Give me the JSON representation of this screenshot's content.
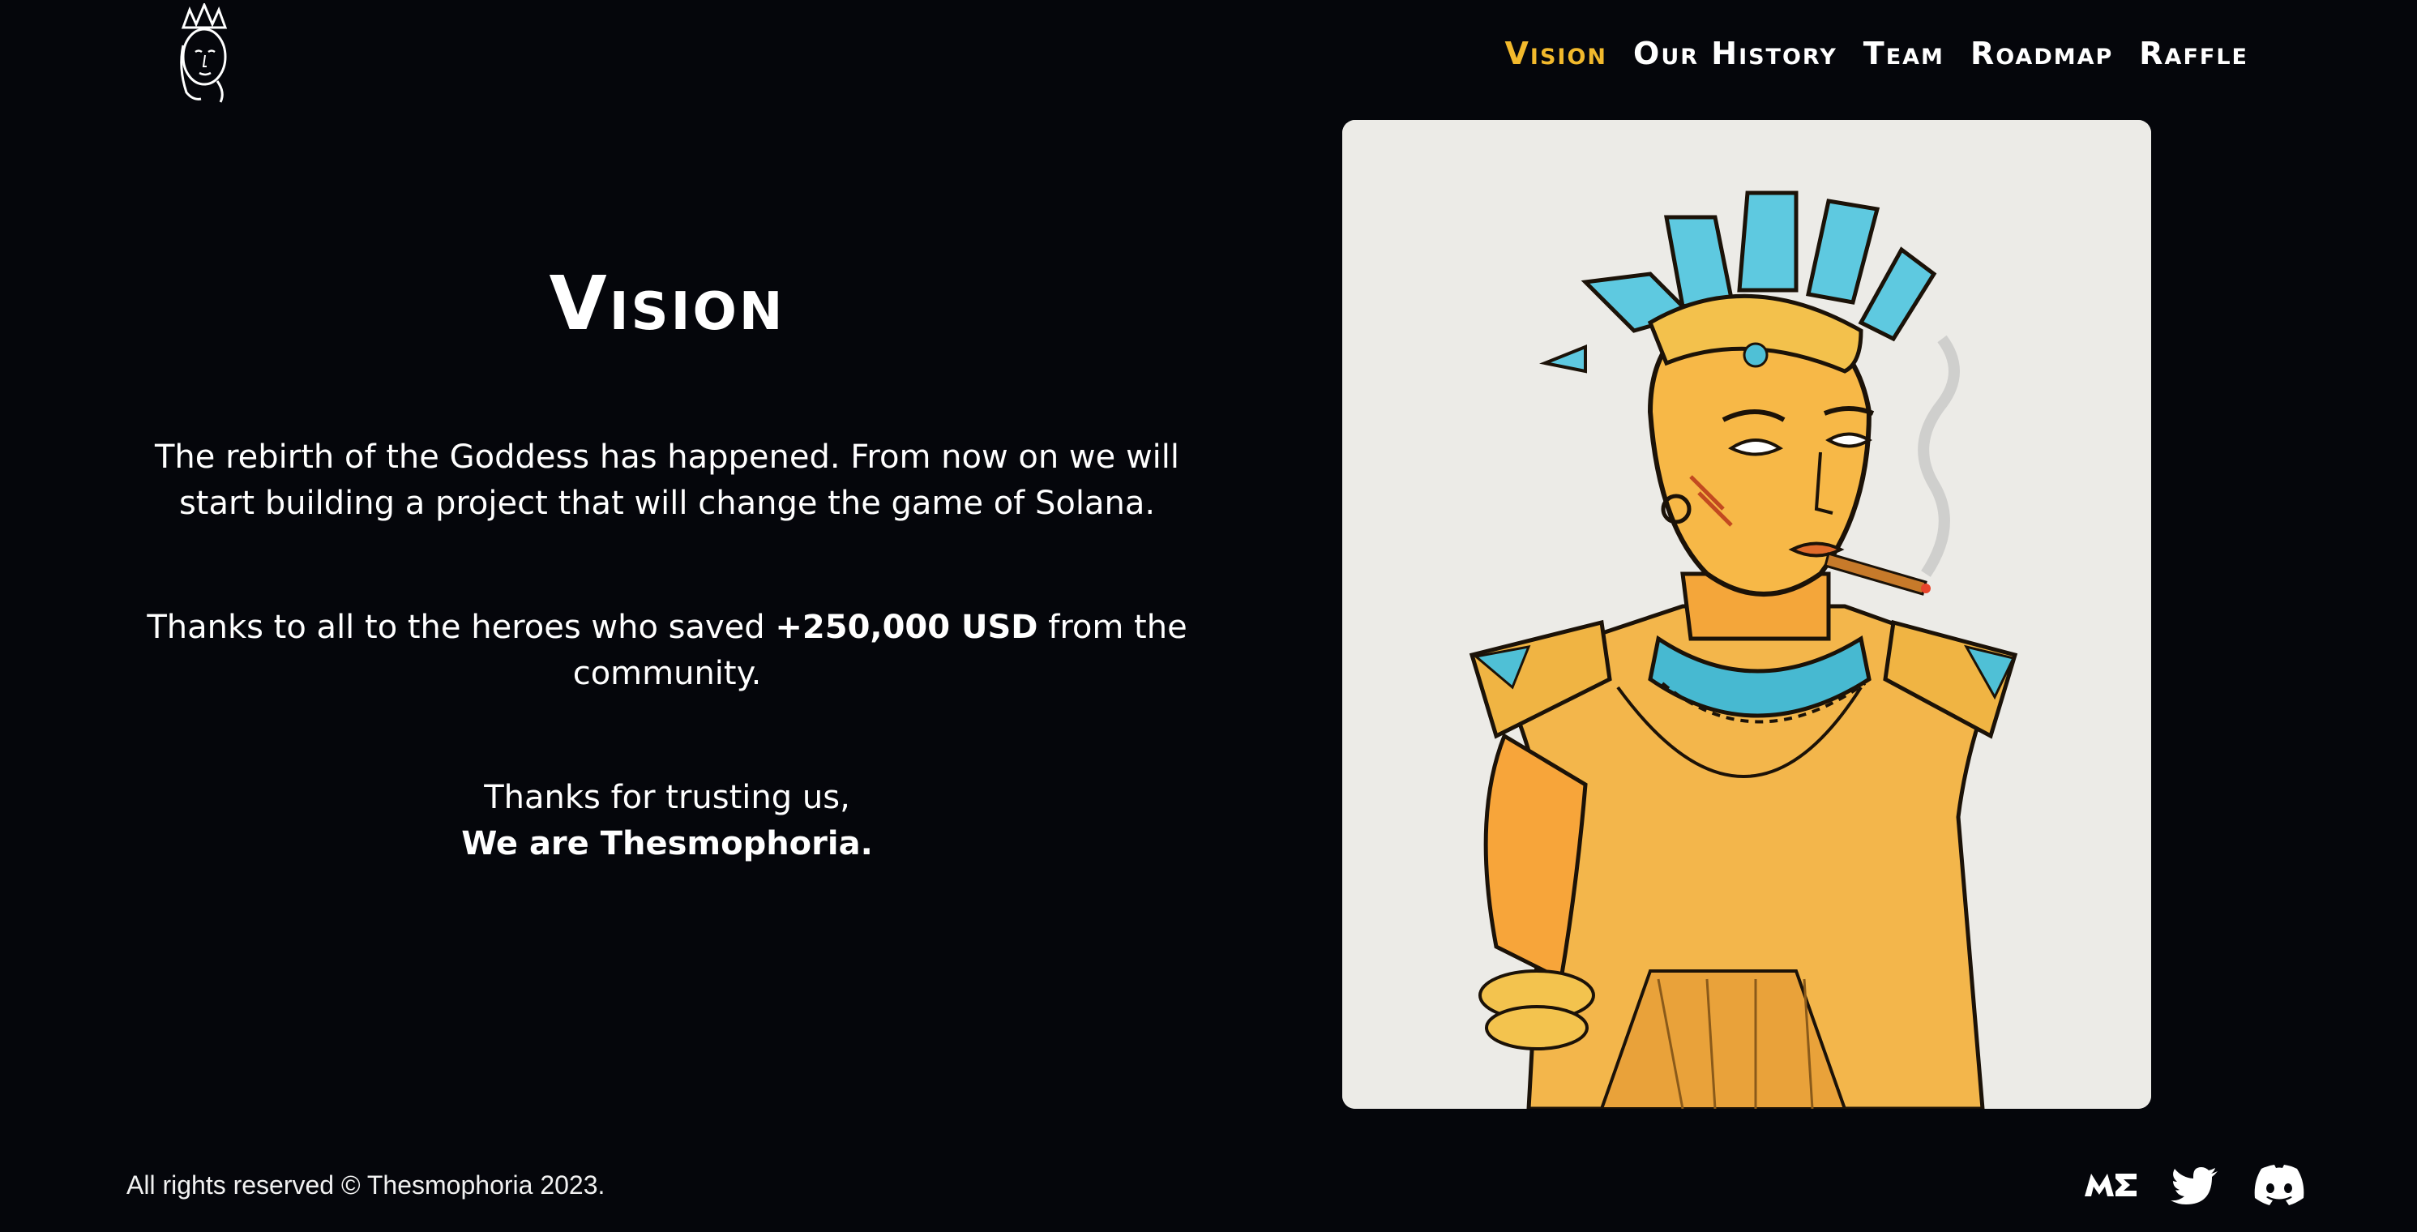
{
  "header": {
    "logo": "goddess-head-logo",
    "nav": [
      {
        "label": "Vision",
        "active": true
      },
      {
        "label": "Our History",
        "active": false
      },
      {
        "label": "Team",
        "active": false
      },
      {
        "label": "Roadmap",
        "active": false
      },
      {
        "label": "Raffle",
        "active": false
      }
    ]
  },
  "main": {
    "title": "Vision",
    "p1": "The rebirth of the Goddess has happened. From now on we will start building a project that will change the game of Solana.",
    "p2_before": "Thanks to all to the heroes who saved ",
    "p2_bold": "+250,000 USD",
    "p2_after": " from the community.",
    "p3_line1": "Thanks for trusting us,",
    "p3_line2": "We are Thesmophoria."
  },
  "footer": {
    "copyright": "All rights reserved © Thesmophoria 2023.",
    "socials": [
      "magic-eden-icon",
      "twitter-icon",
      "discord-icon"
    ]
  },
  "colors": {
    "background": "#05060b",
    "accent": "#f2b92c",
    "card": "#ecebe7"
  }
}
